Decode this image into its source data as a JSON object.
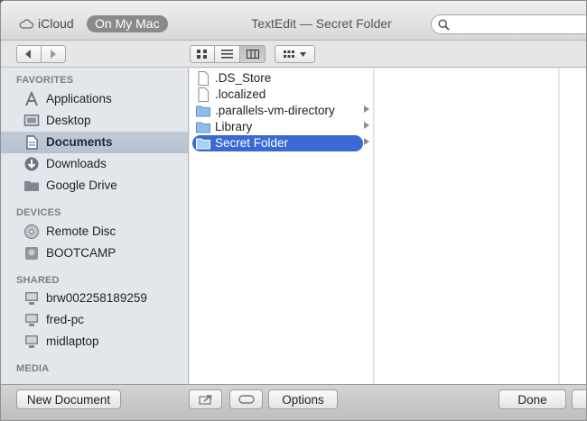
{
  "titlebar": {
    "icloud_label": "iCloud",
    "on_my_mac_label": "On My Mac",
    "title": "TextEdit  —  Secret Folder",
    "search_placeholder": ""
  },
  "toolbar": {
    "back_icon": "chevron-left-icon",
    "forward_icon": "chevron-right-icon",
    "view_modes": [
      "icon-view",
      "list-view",
      "column-view"
    ],
    "active_view": "column-view",
    "arrange_icon": "grid-arrange-icon"
  },
  "sidebar": {
    "sections": [
      {
        "title": "FAVORITES",
        "items": [
          {
            "label": "Applications",
            "icon": "applications-icon"
          },
          {
            "label": "Desktop",
            "icon": "desktop-icon"
          },
          {
            "label": "Documents",
            "icon": "documents-icon",
            "selected": true
          },
          {
            "label": "Downloads",
            "icon": "downloads-icon"
          },
          {
            "label": "Google Drive",
            "icon": "folder-icon"
          }
        ]
      },
      {
        "title": "DEVICES",
        "items": [
          {
            "label": "Remote Disc",
            "icon": "disc-icon"
          },
          {
            "label": "BOOTCAMP",
            "icon": "drive-icon"
          }
        ]
      },
      {
        "title": "SHARED",
        "items": [
          {
            "label": "brw002258189259",
            "icon": "computer-icon"
          },
          {
            "label": "fred-pc",
            "icon": "computer-icon"
          },
          {
            "label": "midlaptop",
            "icon": "computer-icon"
          }
        ]
      },
      {
        "title": "MEDIA",
        "items": []
      }
    ]
  },
  "columns": {
    "first": [
      {
        "name": ".DS_Store",
        "kind": "file",
        "icon": "document-icon"
      },
      {
        "name": ".localized",
        "kind": "file",
        "icon": "document-icon"
      },
      {
        "name": ".parallels-vm-directory",
        "kind": "folder",
        "icon": "folder-icon"
      },
      {
        "name": "Library",
        "kind": "folder",
        "icon": "folder-icon"
      },
      {
        "name": "Secret Folder",
        "kind": "folder",
        "icon": "folder-icon",
        "selected": true
      }
    ]
  },
  "bottombar": {
    "new_document_label": "New Document",
    "share_icon": "share-icon",
    "tag_icon": "tag-icon",
    "options_label": "Options",
    "done_label": "Done"
  },
  "colors": {
    "selection_blue": "#3a69d3",
    "sidebar_bg": "#e3e7ec",
    "sidebar_selected": "#bac4d2"
  }
}
